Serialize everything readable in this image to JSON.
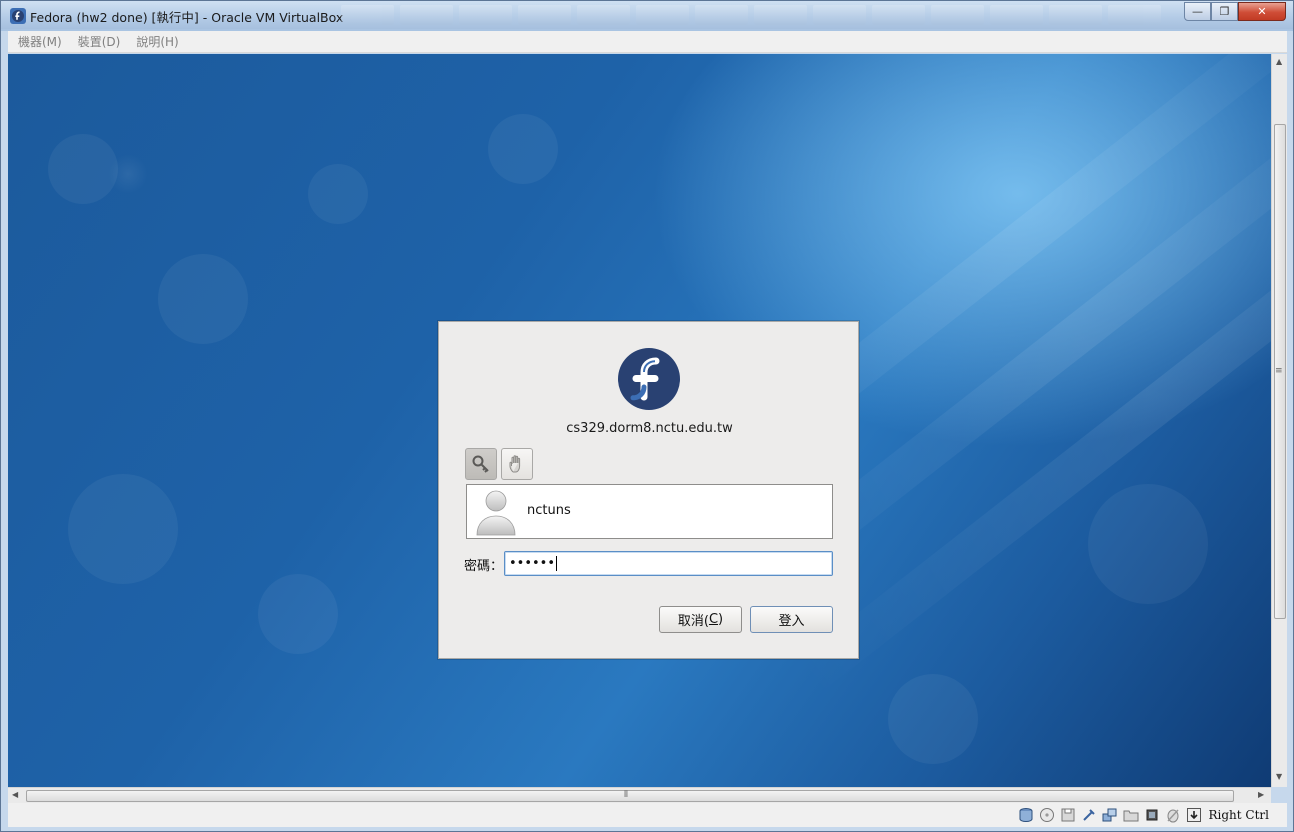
{
  "window": {
    "title": "Fedora (hw2 done) [執行中] - Oracle VM VirtualBox",
    "minimize_label": "—",
    "maximize_label": "❐",
    "close_label": "✕"
  },
  "menubar": {
    "items": [
      {
        "label": "機器(M)"
      },
      {
        "label": "裝置(D)"
      },
      {
        "label": "說明(H)"
      }
    ]
  },
  "login": {
    "hostname": "cs329.dorm8.nctu.edu.tw",
    "user": {
      "name": "nctuns"
    },
    "password_label": "密碼：",
    "password_value": "••••••",
    "cancel_label": "取消(",
    "cancel_mnemonic": "C",
    "cancel_suffix": ")",
    "login_label": "登入"
  },
  "statusbar": {
    "host_key": "Right Ctrl"
  },
  "colors": {
    "desktop": "#1e62a8",
    "fedora_blue": "#294172",
    "dialog_bg": "#edeceb"
  }
}
